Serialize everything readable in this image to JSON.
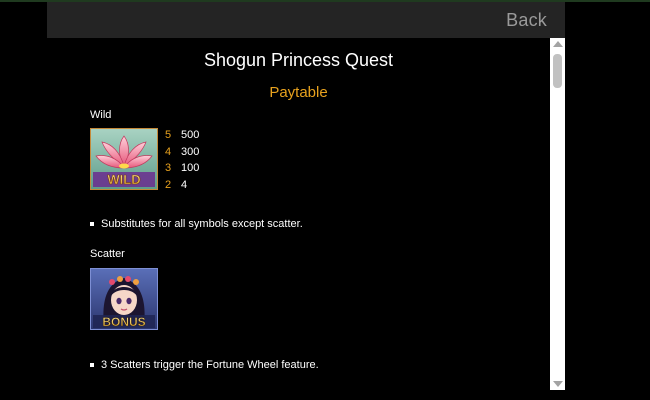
{
  "header": {
    "back_label": "Back"
  },
  "page": {
    "game_title": "Shogun Princess Quest",
    "section_title": "Paytable"
  },
  "wild": {
    "label": "Wild",
    "symbol_text": "WILD",
    "symbol_icon": "lotus-flower-icon",
    "payouts": [
      {
        "count": "5",
        "amount": "500"
      },
      {
        "count": "4",
        "amount": "300"
      },
      {
        "count": "3",
        "amount": "100"
      },
      {
        "count": "2",
        "amount": "4"
      }
    ],
    "note": "Substitutes for all symbols except scatter."
  },
  "scatter": {
    "label": "Scatter",
    "symbol_text": "BONUS",
    "symbol_icon": "princess-portrait-icon",
    "note": "3 Scatters trigger the Fortune Wheel feature."
  },
  "colors": {
    "accent": "#e8a21e",
    "text": "#ffffff",
    "background": "#000000",
    "header": "#242424"
  }
}
